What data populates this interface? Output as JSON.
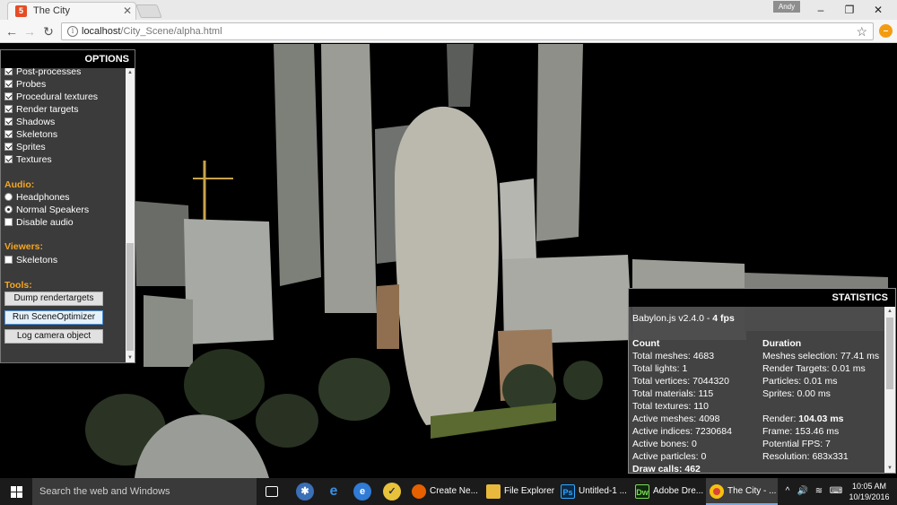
{
  "browser": {
    "tab_title": "The City",
    "tab_close": "✕",
    "user_badge": "Andy",
    "url_host": "localhost",
    "url_path": "/City_Scene/alpha.html",
    "window_controls": [
      "–",
      "❐",
      "✕"
    ]
  },
  "options": {
    "header": "OPTIONS",
    "display_items": [
      {
        "label": "Post-processes",
        "checked": true
      },
      {
        "label": "Probes",
        "checked": true
      },
      {
        "label": "Procedural textures",
        "checked": true
      },
      {
        "label": "Render targets",
        "checked": true
      },
      {
        "label": "Shadows",
        "checked": true
      },
      {
        "label": "Skeletons",
        "checked": true
      },
      {
        "label": "Sprites",
        "checked": true
      },
      {
        "label": "Textures",
        "checked": true
      }
    ],
    "audio": {
      "header": "Audio:",
      "headphones": "Headphones",
      "normal_speakers": "Normal Speakers",
      "disable_audio": "Disable audio"
    },
    "viewers": {
      "header": "Viewers:",
      "skeletons": "Skeletons"
    },
    "tools": {
      "header": "Tools:",
      "dump_rendertargets": "Dump rendertargets",
      "run_sceneoptimizer": "Run SceneOptimizer",
      "log_camera_object": "Log camera object"
    }
  },
  "stats": {
    "header": "STATISTICS",
    "engine": "Babylon.js v2.4.0 - ",
    "fps": "4 fps",
    "count_header": "Count",
    "duration_header": "Duration",
    "count": [
      "Total meshes: 4683",
      "Total lights: 1",
      "Total vertices: 7044320",
      "Total materials: 115",
      "Total textures: 110",
      "Active meshes: 4098",
      "Active indices: 7230684",
      "Active bones: 0",
      "Active particles: 0"
    ],
    "draw_calls": "Draw calls: 462",
    "duration": [
      "Meshes selection: 77.41 ms",
      "Render Targets: 0.01 ms",
      "Particles: 0.01 ms",
      "Sprites: 0.00 ms"
    ],
    "render_label": "Render: ",
    "render_value": "104.03 ms",
    "frame": "Frame: 153.46 ms",
    "potential_fps": "Potential FPS: 7",
    "resolution": "Resolution: 683x331"
  },
  "taskbar": {
    "search_placeholder": "Search the web and Windows",
    "apps": [
      {
        "label": "Create Ne...",
        "icon": "firefox-icon"
      },
      {
        "label": "File Explorer",
        "icon": "folder-icon"
      },
      {
        "label": "Untitled-1 ...",
        "icon": "photoshop-icon",
        "icon_text": "Ps"
      },
      {
        "label": "Adobe Dre...",
        "icon": "dreamweaver-icon",
        "icon_text": "Dw"
      },
      {
        "label": "The City - ...",
        "icon": "chrome-icon"
      }
    ],
    "time": "10:05 AM",
    "date": "10/19/2016"
  }
}
